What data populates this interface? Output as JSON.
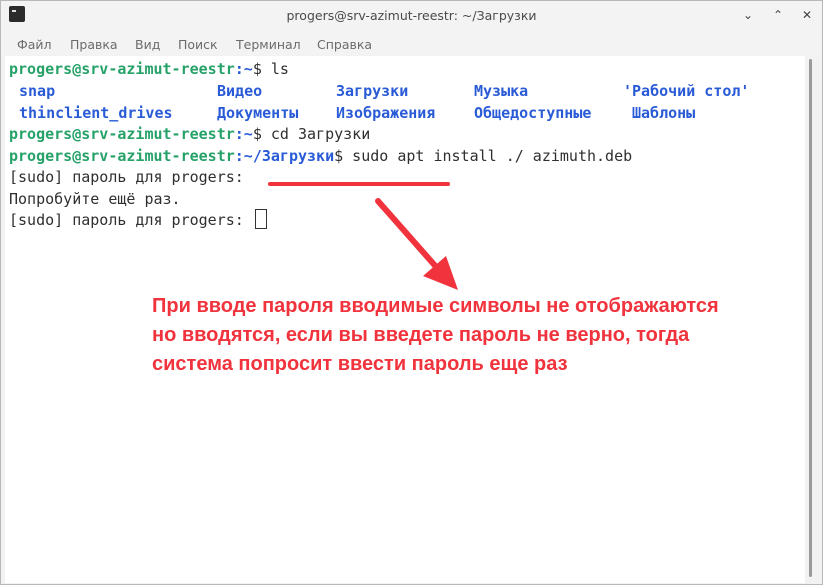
{
  "window": {
    "title": "progers@srv-azimut-reestr: ~/Загрузки",
    "controls": {
      "minimize": "⌄",
      "maximize": "⌃",
      "close": "✕"
    }
  },
  "menubar": {
    "items": [
      "Файл",
      "Правка",
      "Вид",
      "Поиск",
      "Терминал",
      "Справка"
    ]
  },
  "terminal": {
    "line1": {
      "prompt": "progers@srv-azimut-reestr",
      "path": ":~",
      "cmd": "$ ls"
    },
    "ls_rows": [
      [
        "snap",
        "Видео",
        "Загрузки",
        "Музыка",
        "'Рабочий стол'"
      ],
      [
        "thinclient_drives",
        "Документы",
        "Изображения",
        "Общедоступные",
        "Шаблоны"
      ]
    ],
    "line4": {
      "prompt": "progers@srv-azimut-reestr",
      "path": ":~",
      "cmd": "$ cd Загрузки"
    },
    "line5": {
      "prompt": "progers@srv-azimut-reestr",
      "path": ":~/Загрузки",
      "cmd": "$ sudo apt install ./ azimuth.deb"
    },
    "line6": "[sudo] пароль для progers:",
    "line7": "Попробуйте ещё раз.",
    "line8": "[sudo] пароль для progers: "
  },
  "annotation": {
    "lines": [
      "При вводе пароля вводимые символы не отображаются",
      "но вводятся, если вы введете пароль не верно, тогда",
      "система попросит ввести пароль еще раз"
    ],
    "color": "#f0333c"
  },
  "colors": {
    "prompt": "#26a269",
    "directory": "#2a5bd7",
    "annotation": "#f0333c"
  }
}
